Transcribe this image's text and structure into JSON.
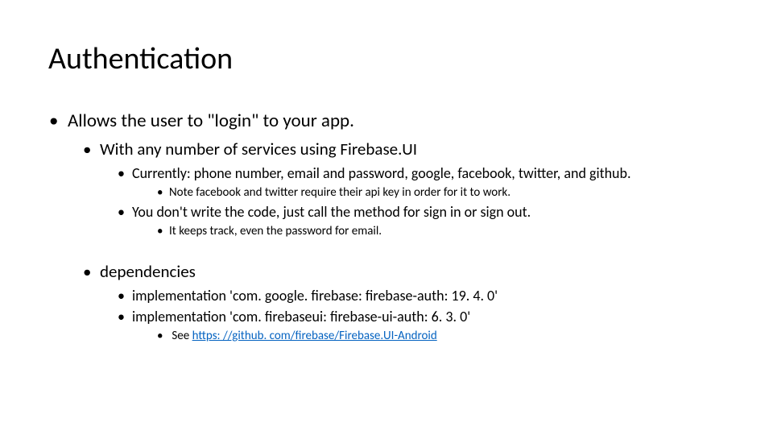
{
  "title": "Authentication",
  "lines": {
    "l1": "Allows the user to \"login\" to your app.",
    "l2": "With any number of services using Firebase.UI",
    "l3": "Currently: phone number, email and password, google, facebook, twitter, and github.",
    "l4": "Note facebook and twitter require their api key in order for it to work.",
    "l5": "You don't write the code, just call the method for sign in or sign out.",
    "l6": "It keeps track, even the password for email.",
    "l7": "dependencies",
    "l8": "implementation 'com. google. firebase: firebase-auth: 19. 4. 0'",
    "l9": "implementation 'com. firebaseui: firebase-ui-auth: 6. 3. 0'",
    "l10_prefix": "See ",
    "l10_link": "https: //github. com/firebase/Firebase.UI-Android"
  }
}
